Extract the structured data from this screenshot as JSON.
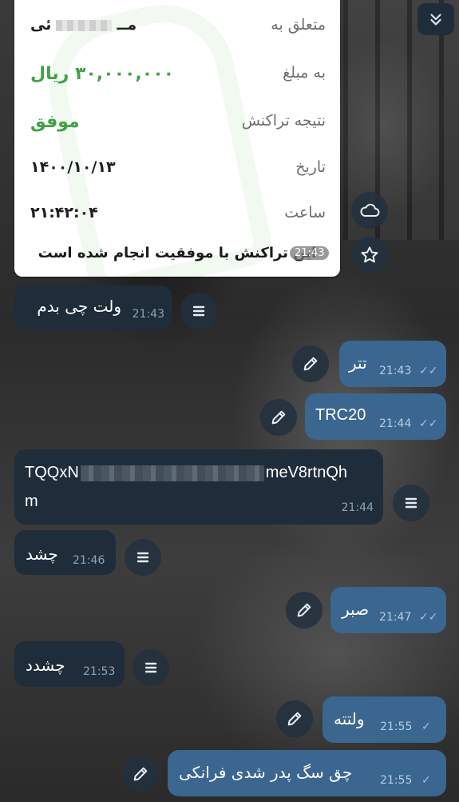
{
  "receipt": {
    "rows": [
      {
        "label": "متعلق به",
        "value_prefix": "مــ",
        "value_suffix": "ئی"
      },
      {
        "label": "به مبلغ",
        "value": "۳۰,۰۰۰,۰۰۰ ریال"
      },
      {
        "label": "نتیجه تراکنش",
        "value": "موفق"
      },
      {
        "label": "تاریخ",
        "value": "۱۴۰۰/۱۰/۱۳"
      },
      {
        "label": "ساعت",
        "value": "۲۱:۴۲:۰۴"
      }
    ],
    "footer": "این تراکنش با موفقیت انجام شده است",
    "time": "21:43",
    "accent": "#43a047"
  },
  "messages": [
    {
      "dir": "in",
      "text": "ولت چی بدم",
      "time": "21:43"
    },
    {
      "dir": "out",
      "text": "تتر",
      "time": "21:43",
      "status": "read"
    },
    {
      "dir": "out",
      "text": "TRC20",
      "time": "21:44",
      "status": "read"
    },
    {
      "dir": "in",
      "text_start": "TQQxN",
      "text_end": "meV8rtnQh",
      "text_line2": "m",
      "time": "21:44"
    },
    {
      "dir": "in",
      "text": "چشد",
      "time": "21:46"
    },
    {
      "dir": "out",
      "text": "صبر",
      "time": "21:47",
      "status": "read"
    },
    {
      "dir": "in",
      "text": "چشدد",
      "time": "21:53"
    },
    {
      "dir": "out",
      "text": "ولتته",
      "time": "21:55",
      "status": "sent"
    },
    {
      "dir": "out",
      "text": "چق سگ پدر شدی فرانکی",
      "time": "21:55",
      "status": "sent"
    }
  ],
  "icons": {
    "read": "✓✓",
    "sent": "✓",
    "scroll": "chevrons-down-icon",
    "cloud": "cloud-icon",
    "star": "star-icon",
    "menu": "menu-icon",
    "edit": "pencil-icon"
  },
  "colors": {
    "incoming": "#1f2c3a",
    "outgoing": "#3a6690"
  }
}
